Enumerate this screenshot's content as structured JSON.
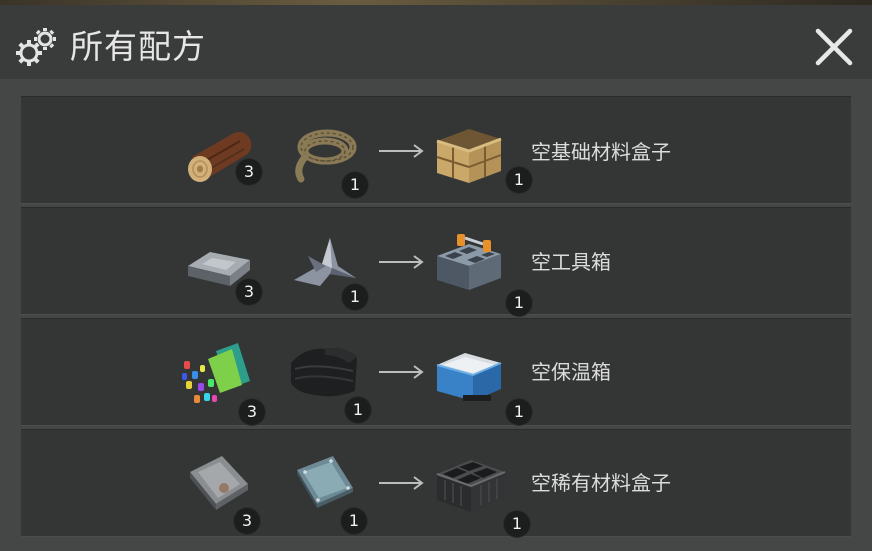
{
  "dialog": {
    "title": "所有配方",
    "icons": {
      "title": "gears-icon",
      "close": "close-icon"
    }
  },
  "recipes": [
    {
      "ingredients": [
        {
          "icon": "wood-log-icon",
          "count": "3"
        },
        {
          "icon": "rope-icon",
          "count": "1"
        }
      ],
      "result": {
        "icon": "wooden-crate-icon",
        "count": "1",
        "name": "空基础材料盒子"
      }
    },
    {
      "ingredients": [
        {
          "icon": "metal-ingot-icon",
          "count": "3"
        },
        {
          "icon": "scrap-metal-icon",
          "count": "1"
        }
      ],
      "result": {
        "icon": "toolbox-icon",
        "count": "1",
        "name": "空工具箱"
      }
    },
    {
      "ingredients": [
        {
          "icon": "plastic-scraps-icon",
          "count": "3"
        },
        {
          "icon": "black-fabric-icon",
          "count": "1"
        }
      ],
      "result": {
        "icon": "cooler-box-icon",
        "count": "1",
        "name": "空保温箱"
      }
    },
    {
      "ingredients": [
        {
          "icon": "steel-plate-icon",
          "count": "3"
        },
        {
          "icon": "alloy-plate-icon",
          "count": "1"
        }
      ],
      "result": {
        "icon": "rare-material-box-icon",
        "count": "1",
        "name": "空稀有材料盒子"
      }
    }
  ]
}
